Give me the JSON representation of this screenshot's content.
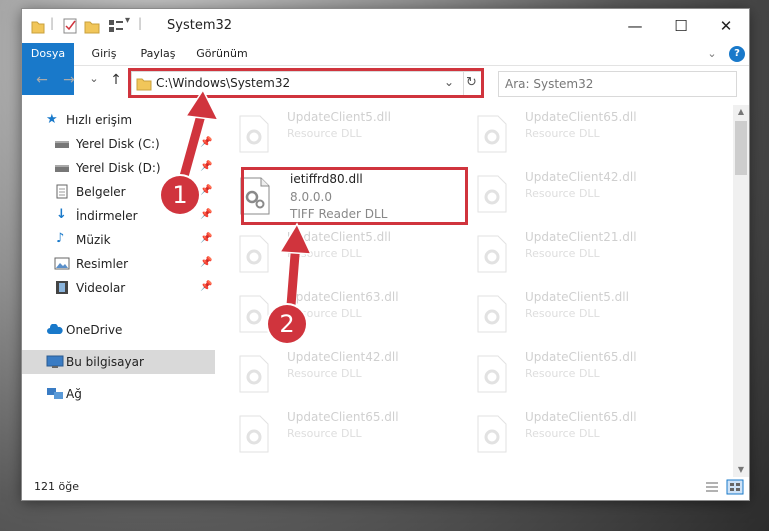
{
  "window": {
    "title": "System32",
    "minimize_glyph": "—",
    "maximize_glyph": "☐",
    "close_glyph": "✕"
  },
  "ribbon": {
    "tabs": [
      "Dosya",
      "Giriş",
      "Paylaş",
      "Görünüm"
    ],
    "expand_glyph": "⌄",
    "help_glyph": "?"
  },
  "address": {
    "path": "C:\\Windows\\System32",
    "dropdown_glyph": "⌄",
    "refresh_glyph": "↻",
    "search_placeholder": "Ara: System32"
  },
  "nav_buttons": {
    "back": "←",
    "forward": "→",
    "recent": "⌄",
    "up": "↑"
  },
  "nav_pane": {
    "quick_access": "Hızlı erişim",
    "items": [
      "Yerel Disk (C:)",
      "Yerel Disk (D:)",
      "Belgeler",
      "İndirmeler",
      "Müzik",
      "Resimler",
      "Videolar"
    ],
    "onedrive": "OneDrive",
    "this_pc": "Bu bilgisayar",
    "network": "Ağ"
  },
  "content": {
    "selected_file": {
      "name": "ietiffrd80.dll",
      "version": "8.0.0.0",
      "description": "TIFF Reader DLL"
    },
    "faded_left": [
      {
        "name": "UpdateClient5.dll",
        "type": "Resource DLL"
      },
      {
        "name": "UpdateClient5.dll",
        "type": "Resource DLL"
      },
      {
        "name": "UpdateClient63.dll",
        "type": "Resource DLL"
      },
      {
        "name": "UpdateClient42.dll",
        "type": "Resource DLL"
      },
      {
        "name": "UpdateClient65.dll",
        "type": "Resource DLL"
      }
    ],
    "faded_right": [
      {
        "name": "UpdateClient65.dll",
        "type": "Resource DLL"
      },
      {
        "name": "UpdateClient42.dll",
        "type": "Resource DLL"
      },
      {
        "name": "UpdateClient21.dll",
        "type": "Resource DLL"
      },
      {
        "name": "UpdateClient5.dll",
        "type": "Resource DLL"
      },
      {
        "name": "UpdateClient65.dll",
        "type": "Resource DLL"
      },
      {
        "name": "UpdateClient65.dll",
        "type": "Resource DLL"
      }
    ]
  },
  "status": {
    "item_count": "121 öğe"
  },
  "annotations": {
    "badge1": "1",
    "badge2": "2",
    "accent_color": "#d0343d"
  }
}
